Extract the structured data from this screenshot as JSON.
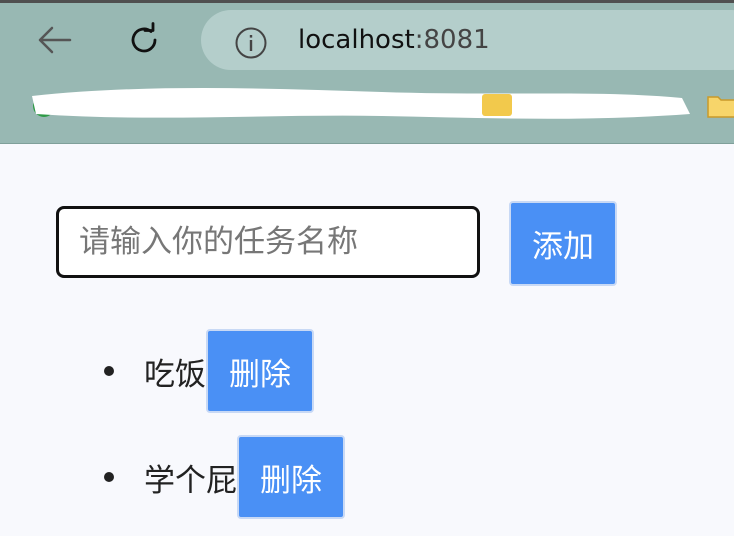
{
  "browser": {
    "url_host": "localhost",
    "url_port": ":8081"
  },
  "todo": {
    "input_placeholder": "请输入你的任务名称",
    "add_label": "添加",
    "tasks": [
      {
        "name": "吃饭",
        "delete_label": "删除"
      },
      {
        "name": "学个屁",
        "delete_label": "删除"
      }
    ]
  },
  "colors": {
    "chrome": "#98b8b3",
    "address_bar": "#b4cecb",
    "button": "#4a90f5",
    "page_bg": "#f8f9fd"
  }
}
